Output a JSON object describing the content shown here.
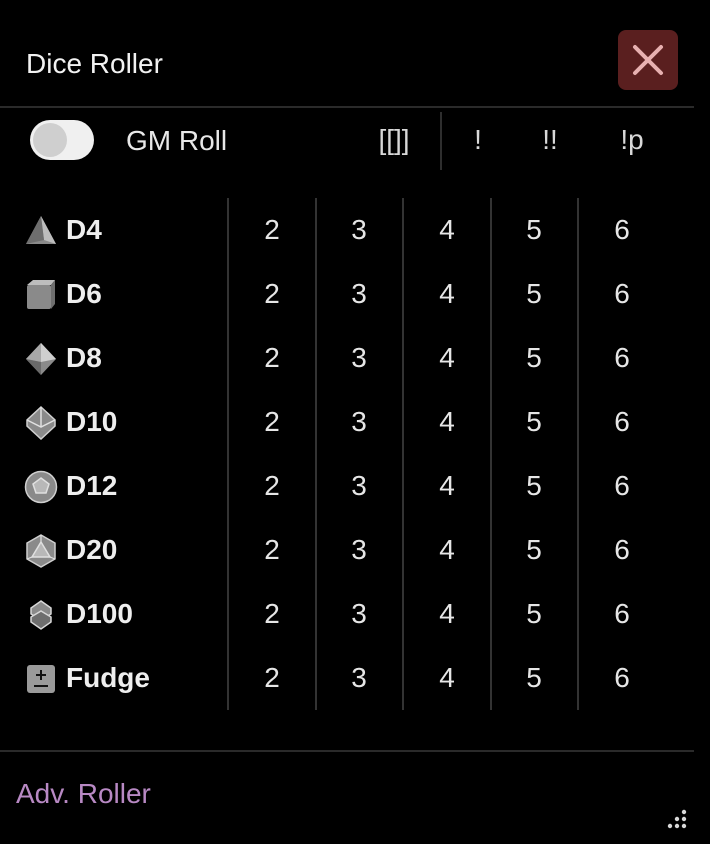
{
  "window": {
    "title": "Dice Roller",
    "close_icon": "close-x-icon",
    "close_color": "#5a1f1f"
  },
  "toolbar": {
    "gm_roll_label": "GM Roll",
    "gm_roll_enabled": false,
    "buttons": [
      "[[]]",
      "!",
      "!!",
      "!p"
    ]
  },
  "dice": [
    {
      "name": "D4",
      "icon": "d4-tetrahedron-icon",
      "counts": [
        "2",
        "3",
        "4",
        "5",
        "6"
      ]
    },
    {
      "name": "D6",
      "icon": "d6-cube-icon",
      "counts": [
        "2",
        "3",
        "4",
        "5",
        "6"
      ]
    },
    {
      "name": "D8",
      "icon": "d8-octahedron-icon",
      "counts": [
        "2",
        "3",
        "4",
        "5",
        "6"
      ]
    },
    {
      "name": "D10",
      "icon": "d10-icon",
      "counts": [
        "2",
        "3",
        "4",
        "5",
        "6"
      ]
    },
    {
      "name": "D12",
      "icon": "d12-dodecahedron-icon",
      "counts": [
        "2",
        "3",
        "4",
        "5",
        "6"
      ]
    },
    {
      "name": "D20",
      "icon": "d20-icosahedron-icon",
      "counts": [
        "2",
        "3",
        "4",
        "5",
        "6"
      ]
    },
    {
      "name": "D100",
      "icon": "d100-icon",
      "counts": [
        "2",
        "3",
        "4",
        "5",
        "6"
      ]
    },
    {
      "name": "Fudge",
      "icon": "fudge-plus-minus-icon",
      "counts": [
        "2",
        "3",
        "4",
        "5",
        "6"
      ]
    }
  ],
  "footer": {
    "adv_roller_label": "Adv. Roller",
    "link_color": "#b889c4"
  }
}
